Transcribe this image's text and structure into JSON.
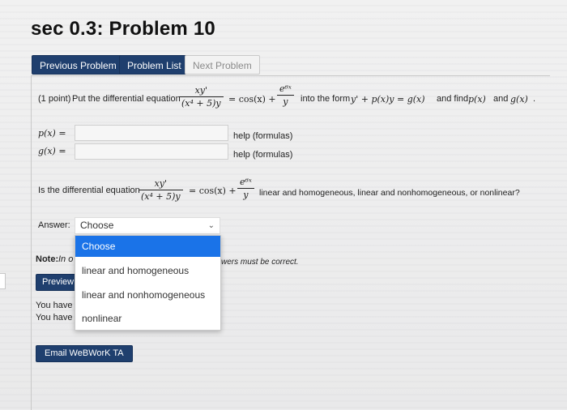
{
  "header": {
    "title": "sec 0.3: Problem 10",
    "prev_label": "Previous Problem",
    "list_label": "Problem List",
    "next_label": "Next Problem"
  },
  "problem": {
    "points": "(1 point)",
    "intro": "Put the differential equation",
    "frac1_num": "xy'",
    "frac1_den": "(x⁴ + 5)y",
    "eq_cos": "= cos(x) +",
    "frac2_num": "e⁶ˣ",
    "frac2_den": "y",
    "into_text": "into the form",
    "form": "y' + p(x)y = g(x)",
    "and_find": "and find",
    "p_of_x": "p(x)",
    "and": "and",
    "g_of_x": "g(x)",
    "period": "."
  },
  "fields": [
    {
      "label": "p(x) =",
      "help": "help (formulas)",
      "value": ""
    },
    {
      "label": "g(x) =",
      "help": "help (formulas)",
      "value": ""
    }
  ],
  "question2": {
    "prefix": "Is the differential equation",
    "frac1_num": "xy'",
    "frac1_den": "(x⁴ + 5)y",
    "eq_cos": "= cos(x) +",
    "frac2_num": "e⁶ˣ",
    "frac2_den": "y",
    "suffix": "linear and homogeneous, linear and nonhomogeneous, or nonlinear?"
  },
  "answer": {
    "label": "Answer:",
    "selected": "Choose",
    "options": [
      "Choose",
      "linear and homogeneous",
      "linear and nonhomogeneous",
      "nonlinear"
    ]
  },
  "note": {
    "bold": "Note:",
    "partial_left": "In o",
    "partial_right": "wers must be correct."
  },
  "preview_label": "Preview",
  "attempts": {
    "line1": "You have a",
    "line2": "You have u"
  },
  "email_label": "Email WeBWorK TA"
}
